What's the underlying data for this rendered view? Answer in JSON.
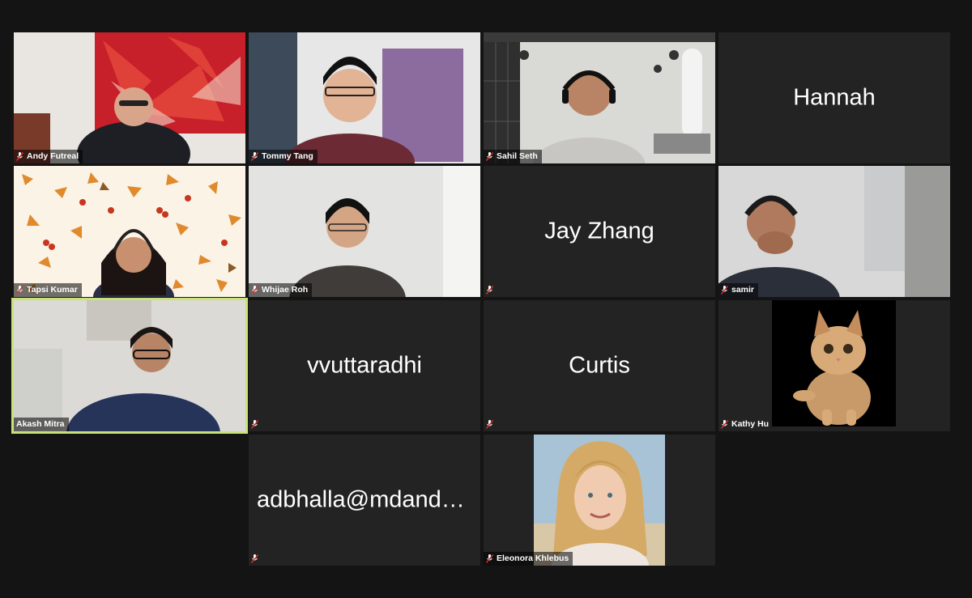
{
  "participants": [
    {
      "name": "Andy Futreal",
      "video": true,
      "muted": true
    },
    {
      "name": "Tommy Tang",
      "video": true,
      "muted": true
    },
    {
      "name": "Sahil Seth",
      "video": true,
      "muted": true
    },
    {
      "name": "Hannah",
      "video": false,
      "display_name": "Hannah"
    },
    {
      "name": "Tapsi Kumar",
      "video": true,
      "muted": true
    },
    {
      "name": "Whijae Roh",
      "video": true,
      "muted": true
    },
    {
      "name": "Jay Zhang",
      "video": false,
      "display_name": "Jay Zhang",
      "muted": true
    },
    {
      "name": "samir",
      "video": true,
      "muted": true
    },
    {
      "name": "Akash Mitra",
      "video": true,
      "muted": false,
      "speaking": true
    },
    {
      "name": "vvuttaradhi",
      "video": false,
      "display_name": "vvuttaradhi",
      "muted": true
    },
    {
      "name": "Curtis",
      "video": false,
      "display_name": "Curtis",
      "muted": true
    },
    {
      "name": "Kathy Hu",
      "video": false,
      "profile_picture": "cat-photo",
      "muted": true
    },
    {
      "name": "adbhalla@mdanderson",
      "video": false,
      "display_name": "adbhalla@mdander...",
      "muted": true
    },
    {
      "name": "Eleonora Khlebus",
      "video": false,
      "profile_picture": "portrait-photo",
      "muted": true
    }
  ],
  "colors": {
    "background": "#141414",
    "tile": "#232323",
    "active_speaker_border": "#c9e27a",
    "muted_icon": "#e0332b"
  },
  "icons": {
    "muted": "mic-muted-icon"
  }
}
